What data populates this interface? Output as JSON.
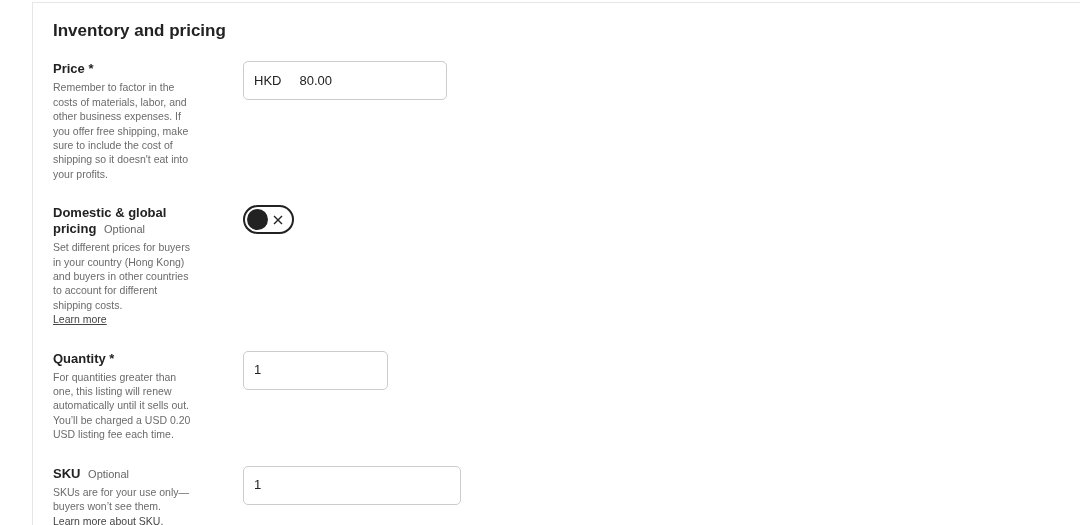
{
  "section": {
    "title": "Inventory and pricing"
  },
  "fields": [
    {
      "kind": "price",
      "label": "Price *",
      "description": "Remember to factor in the costs of materials, labor, and other business expenses. If you offer free shipping, make sure to include the cost of shipping so it doesn't eat into your profits.",
      "prefix": "HKD",
      "value": "80.00"
    },
    {
      "kind": "toggle",
      "label": "Domestic & global pricing",
      "tag": "Optional",
      "description": "Set different prices for buyers in your country (Hong Kong) and buyers in other countries to account for different shipping costs.",
      "link": {
        "text": "Learn more",
        "own_line": true
      },
      "on": false
    },
    {
      "kind": "text",
      "label": "Quantity *",
      "description": "For quantities greater than one, this listing will renew automatically until it sells out. You’ll be charged a USD 0.20 USD listing fee each time.",
      "value": "1"
    },
    {
      "kind": "text",
      "label": "SKU",
      "tag": "Optional",
      "description": "SKUs are for your use only—buyers won’t see them.",
      "link": {
        "text": "Learn more about SKU.",
        "own_line": false
      },
      "value": "1"
    }
  ]
}
